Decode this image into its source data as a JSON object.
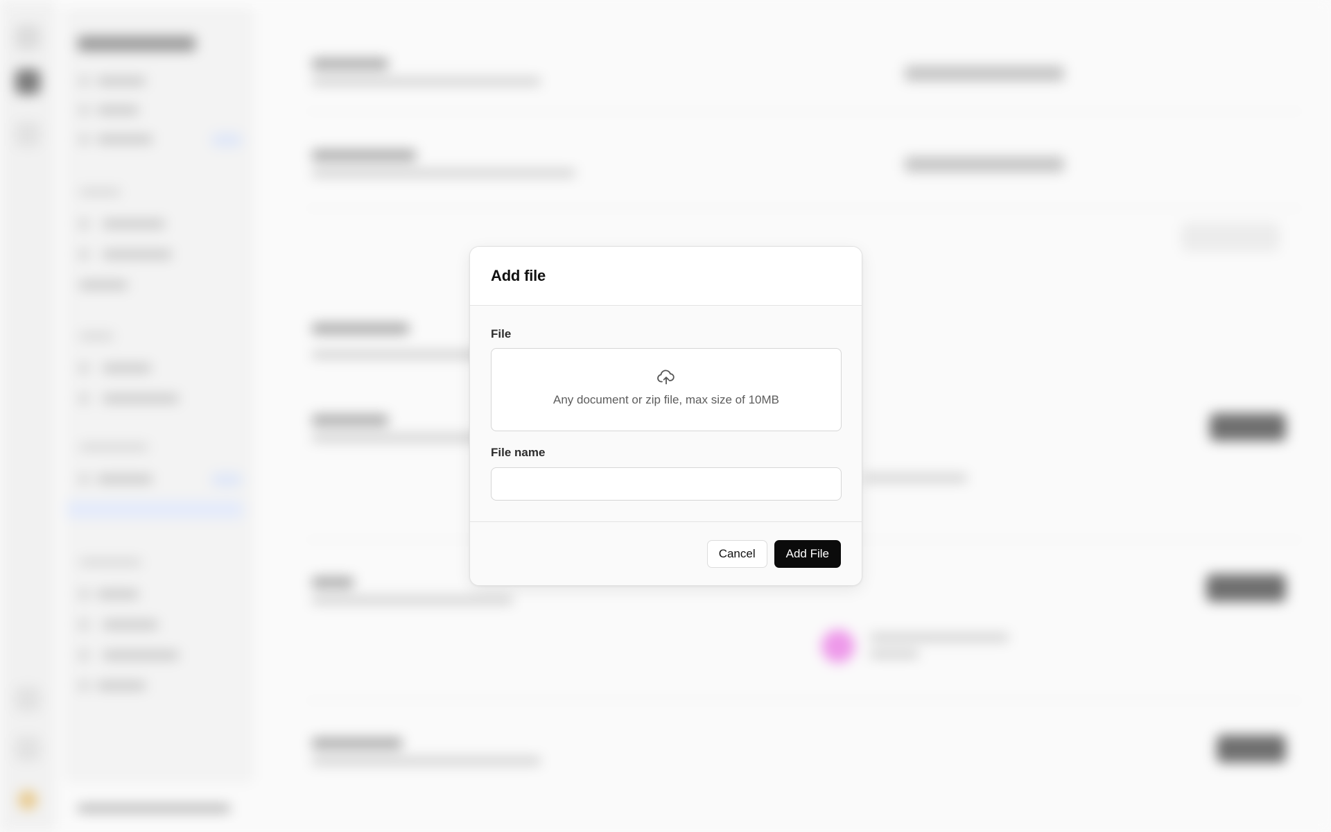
{
  "modal": {
    "title": "Add file",
    "file_label": "File",
    "dropzone_text": "Any document or zip file, max size of 10MB",
    "upload_icon": "cloud-upload-icon",
    "file_name_label": "File name",
    "file_name_value": "",
    "file_name_placeholder": "",
    "cancel_label": "Cancel",
    "submit_label": "Add File"
  },
  "colors": {
    "primary_button": "#0b0b0b",
    "overlay_background": "#fafafa",
    "avatar_accent": "#ee99ea"
  }
}
